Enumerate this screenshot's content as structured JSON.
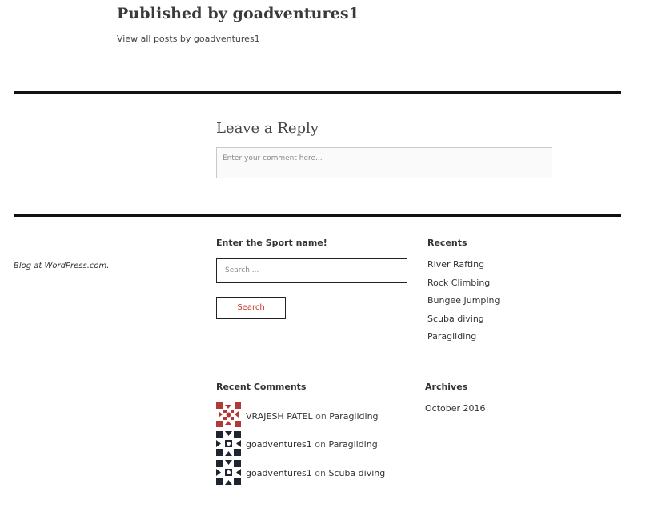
{
  "author": {
    "title": "Published by goadventures1",
    "view_all": "View all posts by goadventures1"
  },
  "reply": {
    "title": "Leave a Reply",
    "placeholder": "Enter your comment here..."
  },
  "footer": {
    "credit": "Blog at WordPress.com."
  },
  "search_widget": {
    "title": "Enter the Sport name!",
    "placeholder": "Search ...",
    "button": "Search"
  },
  "recents": {
    "title": "Recents",
    "items": [
      "River Rafting",
      "Rock Climbing",
      "Bungee Jumping",
      "Scuba diving",
      "Paragliding"
    ]
  },
  "recent_comments": {
    "title": "Recent Comments",
    "items": [
      {
        "author": "VRAJESH PATEL",
        "on": "on",
        "post": "Paragliding",
        "avatar_color": "#b03a3a"
      },
      {
        "author": "goadventures1",
        "on": "on",
        "post": "Paragliding",
        "avatar_color": "#1e2430"
      },
      {
        "author": "goadventures1",
        "on": "on",
        "post": "Scuba diving",
        "avatar_color": "#1e2430"
      }
    ]
  },
  "archives": {
    "title": "Archives",
    "items": [
      "October 2016"
    ]
  }
}
